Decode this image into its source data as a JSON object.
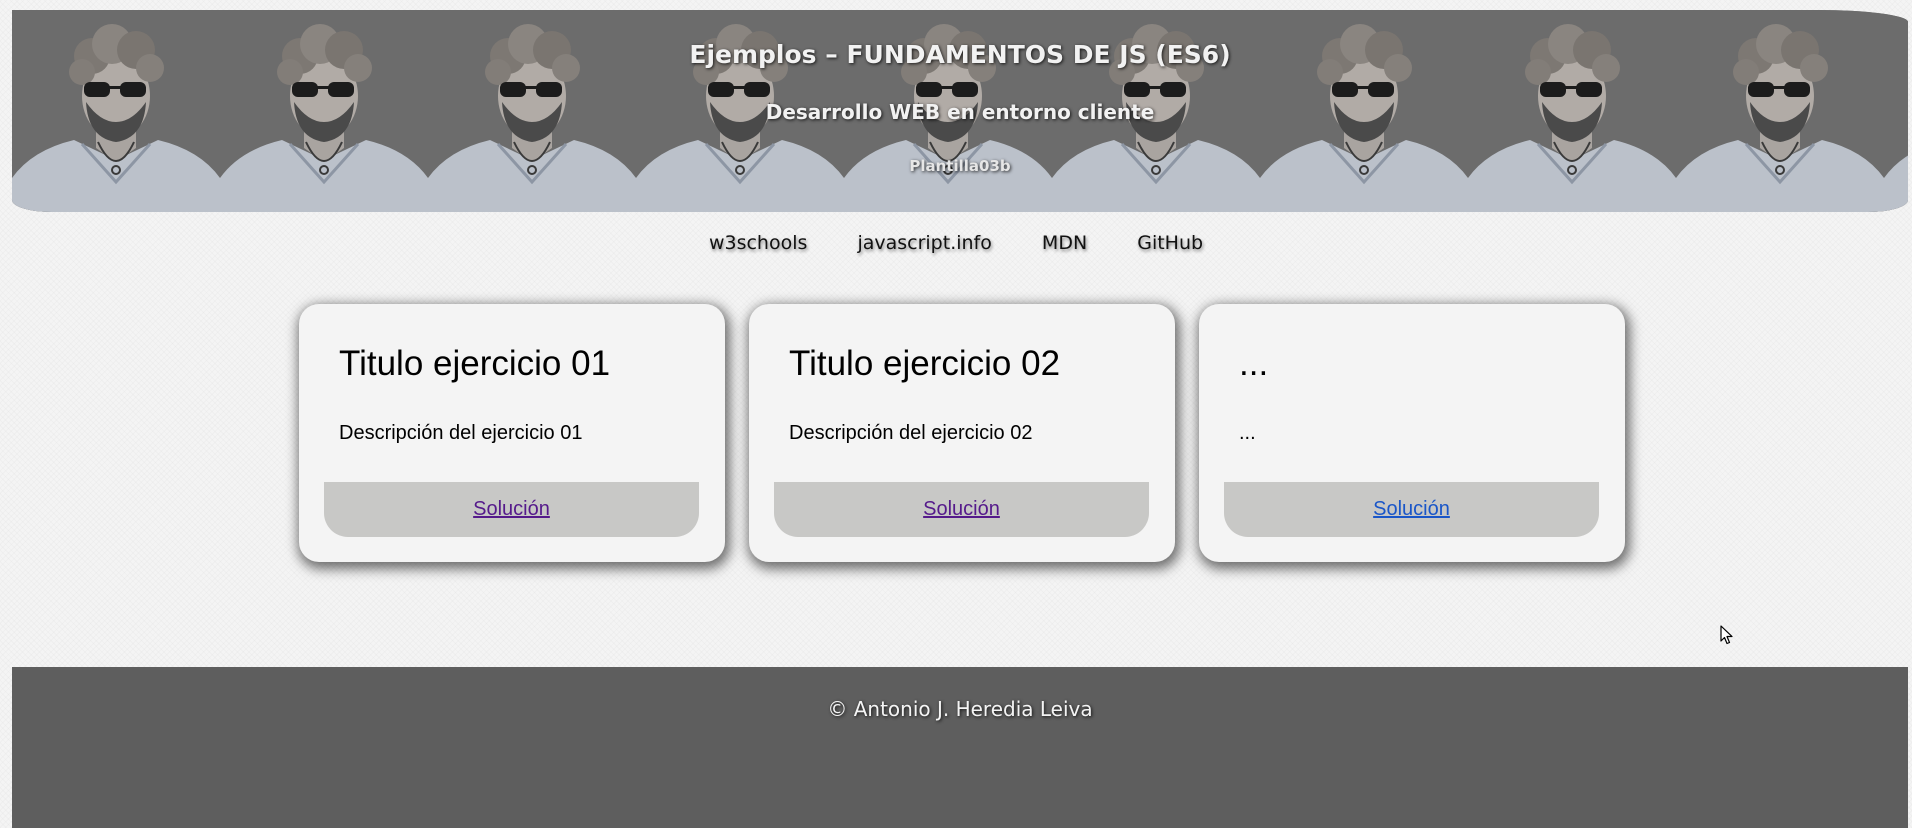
{
  "header": {
    "title": "Ejemplos – FUNDAMENTOS DE JS (ES6)",
    "subtitle": "Desarrollo WEB en entorno cliente",
    "template_name": "Plantilla03b",
    "background_image": "repeated-portrait-photo"
  },
  "nav": {
    "links": [
      {
        "label": "w3schools"
      },
      {
        "label": "javascript.info"
      },
      {
        "label": "MDN"
      },
      {
        "label": "GitHub"
      }
    ]
  },
  "cards": [
    {
      "title": "Titulo ejercicio 01",
      "description": "Descripción del ejercicio 01",
      "link_label": "Solución",
      "link_color": "#551a8b"
    },
    {
      "title": "Titulo ejercicio 02",
      "description": "Descripción del ejercicio 02",
      "link_label": "Solución",
      "link_color": "#551a8b"
    },
    {
      "title": "...",
      "description": "...",
      "link_label": "Solución",
      "link_color": "#1a56c8"
    }
  ],
  "footer": {
    "text": "© Antonio J. Heredia Leiva"
  },
  "colors": {
    "page_background": "#f4f4f4",
    "banner_background": "#6c6c6c",
    "footer_background": "#5e5e5e",
    "card_footer": "#c8c8c6"
  }
}
